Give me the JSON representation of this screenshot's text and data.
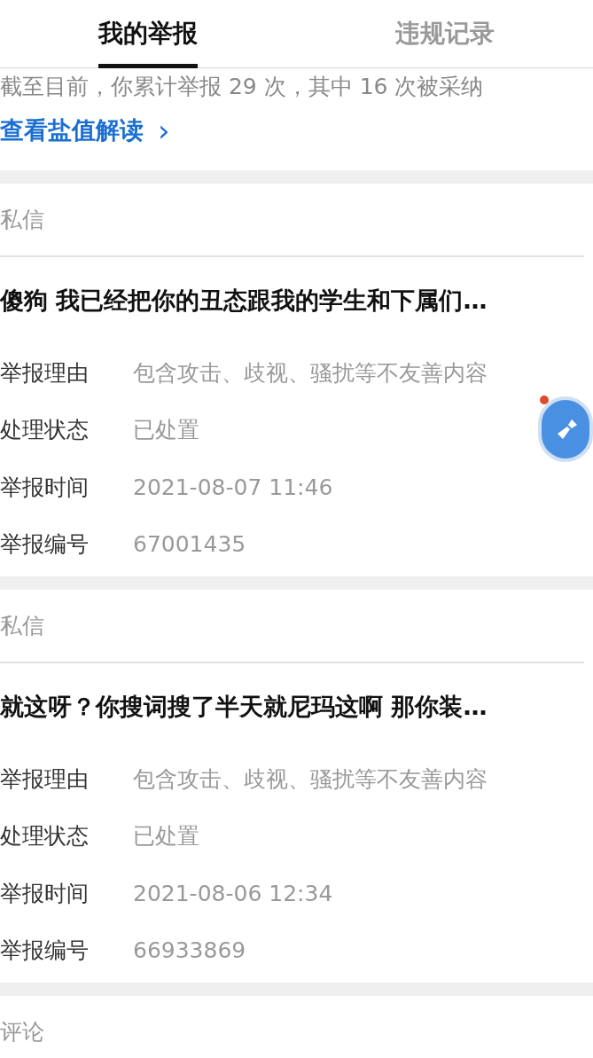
{
  "tabs": [
    {
      "label": "我的举报",
      "selected": true
    },
    {
      "label": "违规记录",
      "selected": false
    }
  ],
  "summary": {
    "text": "截至目前，你累计举报 29 次，其中 16 次被采纳",
    "link": "查看盐值解读",
    "link_icon": "›"
  },
  "reports": [
    {
      "type": "私信",
      "content": "傻狗 我已经把你的丑态跟我的学生和下属们…",
      "fields": [
        {
          "label": "举报理由",
          "value": "包含攻击、歧视、骚扰等不友善内容"
        },
        {
          "label": "处理状态",
          "value": "已处置"
        },
        {
          "label": "举报时间",
          "value": "2021-08-07 11:46"
        },
        {
          "label": "举报编号",
          "value": "67001435"
        }
      ]
    },
    {
      "type": "私信",
      "content": "就这呀？你搜词搜了半天就尼玛这啊 那你装…",
      "fields": [
        {
          "label": "举报理由",
          "value": "包含攻击、歧视、骚扰等不友善内容"
        },
        {
          "label": "处理状态",
          "value": "已处置"
        },
        {
          "label": "举报时间",
          "value": "2021-08-06 12:34"
        },
        {
          "label": "举报编号",
          "value": "66933869"
        }
      ]
    },
    {
      "type": "评论"
    }
  ]
}
